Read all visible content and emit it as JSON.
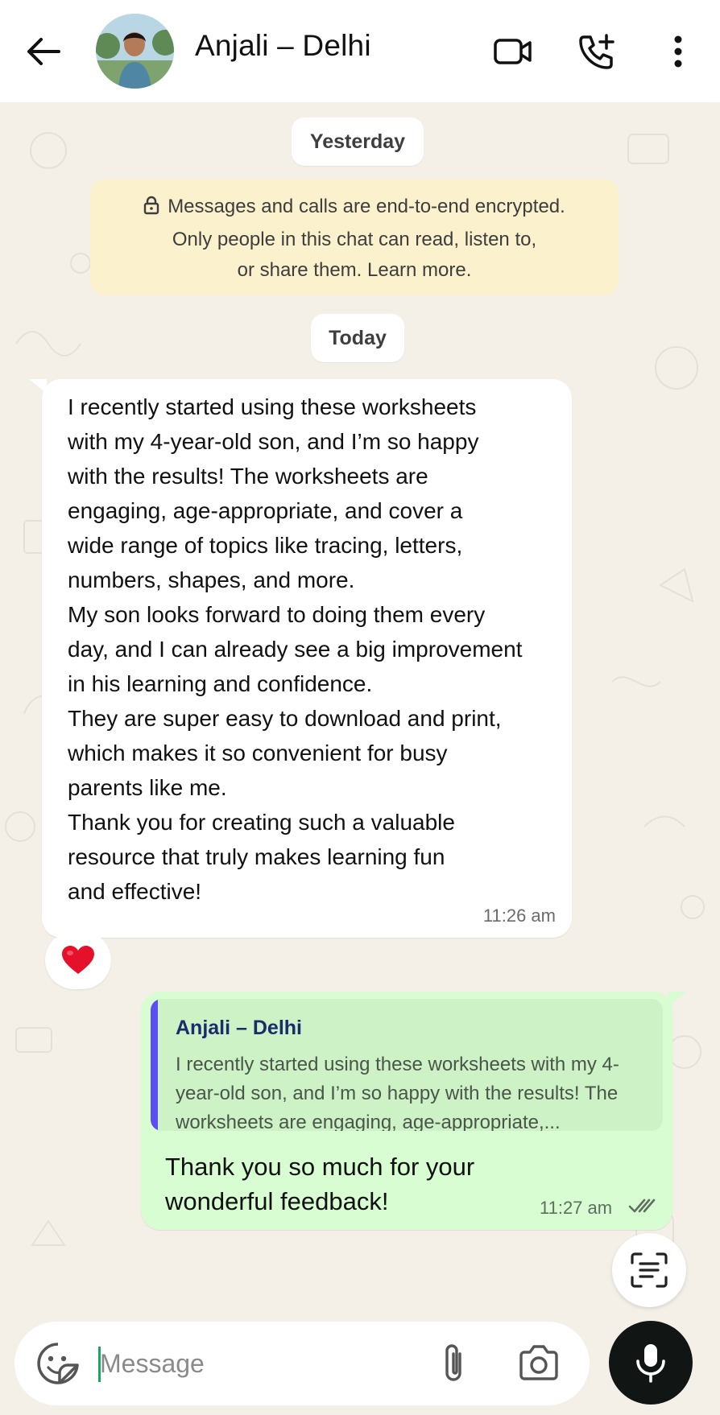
{
  "header": {
    "contact_name": "Anjali – Delhi",
    "icons": [
      "back-arrow-icon",
      "video-call-icon",
      "add-call-icon",
      "more-options-icon"
    ]
  },
  "chat": {
    "date_yesterday": "Yesterday",
    "encryption_notice": {
      "line1": "Messages and calls are end-to-end encrypted.",
      "line2": "Only people in this chat can read, listen to,",
      "line3": "or share them. Learn more."
    },
    "date_today": "Today",
    "incoming": {
      "text": "I recently started using these worksheets\nwith my 4-year-old son, and I’m so happy\nwith the results! The worksheets are\nengaging, age-appropriate, and cover a\nwide range of topics like tracing, letters,\nnumbers, shapes, and more.\nMy son looks forward to doing them every\nday, and I can already see a big improvement\nin his learning and confidence.\nThey are super easy to download and print,\nwhich makes it so convenient for busy\nparents like me.\nThank you for creating such a valuable\nresource that truly makes learning fun\nand effective!",
      "time": "11:26 am",
      "reaction": "❤️"
    },
    "outgoing": {
      "quoted_name": "Anjali – Delhi",
      "quoted_text": "I recently started using these worksheets with my 4-year-old son, and I’m so happy with the results! The worksheets are engaging, age-appropriate,...",
      "text": "Thank you so much for your wonderful feedback!",
      "time": "11:27 am",
      "status": "read-double-tick"
    }
  },
  "composer": {
    "placeholder": "Message",
    "value": ""
  },
  "colors": {
    "wallpaper": "#f4f0e8",
    "outgoing_bubble": "#d8fdd2",
    "quote_bar": "#5b4ef3",
    "encryption_bg": "#fcf1cd",
    "mic_button": "#111614"
  }
}
